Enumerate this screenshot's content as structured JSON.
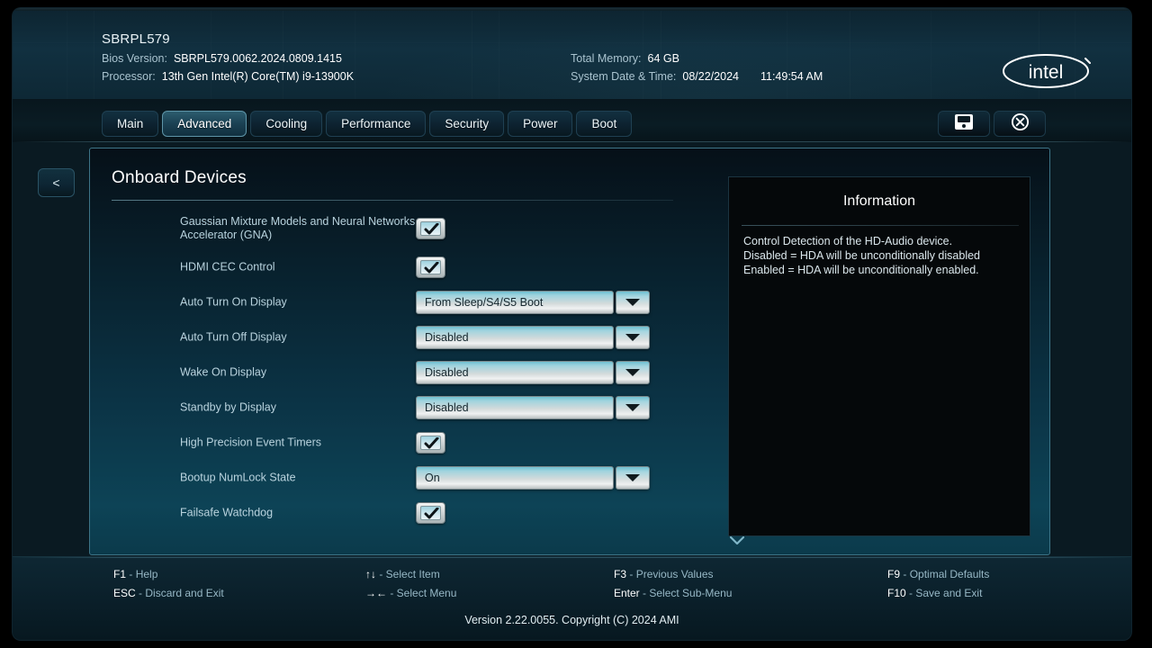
{
  "header": {
    "title": "SBRPL579",
    "bios_version_label": "Bios Version:",
    "bios_version_value": "SBRPL579.0062.2024.0809.1415",
    "processor_label": "Processor:",
    "processor_value": "13th Gen Intel(R) Core(TM) i9-13900K",
    "total_memory_label": "Total Memory:",
    "total_memory_value": "64 GB",
    "system_datetime_label": "System Date & Time:",
    "system_date_value": "08/22/2024",
    "system_time_value": "11:49:54 AM",
    "logo_text": "intel"
  },
  "tabs": [
    {
      "label": "Main",
      "active": false
    },
    {
      "label": "Advanced",
      "active": true
    },
    {
      "label": "Cooling",
      "active": false
    },
    {
      "label": "Performance",
      "active": false
    },
    {
      "label": "Security",
      "active": false
    },
    {
      "label": "Power",
      "active": false
    },
    {
      "label": "Boot",
      "active": false
    }
  ],
  "window_buttons": [
    {
      "name": "save-button",
      "icon": "floppy-disk-icon"
    },
    {
      "name": "exit-button",
      "icon": "close-circle-icon"
    }
  ],
  "back_button": {
    "label": "<"
  },
  "panel": {
    "title": "Onboard Devices",
    "rows": [
      {
        "label": "Gaussian Mixture Models and Neural Networks Accelerator (GNA)",
        "type": "checkbox",
        "checked": true
      },
      {
        "label": "HDMI CEC Control",
        "type": "checkbox",
        "checked": true
      },
      {
        "label": "Auto Turn On Display",
        "type": "dropdown",
        "value": "From Sleep/S4/S5 Boot"
      },
      {
        "label": "Auto Turn Off Display",
        "type": "dropdown",
        "value": "Disabled"
      },
      {
        "label": "Wake On Display",
        "type": "dropdown",
        "value": "Disabled"
      },
      {
        "label": "Standby by Display",
        "type": "dropdown",
        "value": "Disabled"
      },
      {
        "label": "High Precision Event Timers",
        "type": "checkbox",
        "checked": true
      },
      {
        "label": "Bootup NumLock State",
        "type": "dropdown",
        "value": "On"
      },
      {
        "label": "Failsafe Watchdog",
        "type": "checkbox",
        "checked": true
      }
    ]
  },
  "information": {
    "title": "Information",
    "body": "Control Detection of the HD-Audio device.\nDisabled = HDA will be unconditionally disabled\nEnabled = HDA will be unconditionally enabled."
  },
  "footer": {
    "key_columns": [
      [
        {
          "key": "F1",
          "desc": "- Help"
        },
        {
          "key": "ESC",
          "desc": "- Discard and Exit"
        }
      ],
      [
        {
          "key": "↑↓",
          "desc": "- Select Item"
        },
        {
          "key": "→←",
          "desc": "- Select Menu"
        }
      ],
      [
        {
          "key": "F3",
          "desc": "- Previous Values"
        },
        {
          "key": "Enter",
          "desc": "- Select Sub-Menu"
        }
      ],
      [
        {
          "key": "F9",
          "desc": "- Optimal Defaults"
        },
        {
          "key": "F10",
          "desc": "- Save and Exit"
        }
      ]
    ],
    "copyright": "Version 2.22.0055. Copyright (C) 2024 AMI"
  },
  "colors": {
    "accent": "#3d7487",
    "panel_top": "#061018",
    "panel_bottom": "#0d4356",
    "text_primary": "#ffffff",
    "text_secondary": "#b9d3de",
    "active_tab": "#2c5c6e"
  }
}
